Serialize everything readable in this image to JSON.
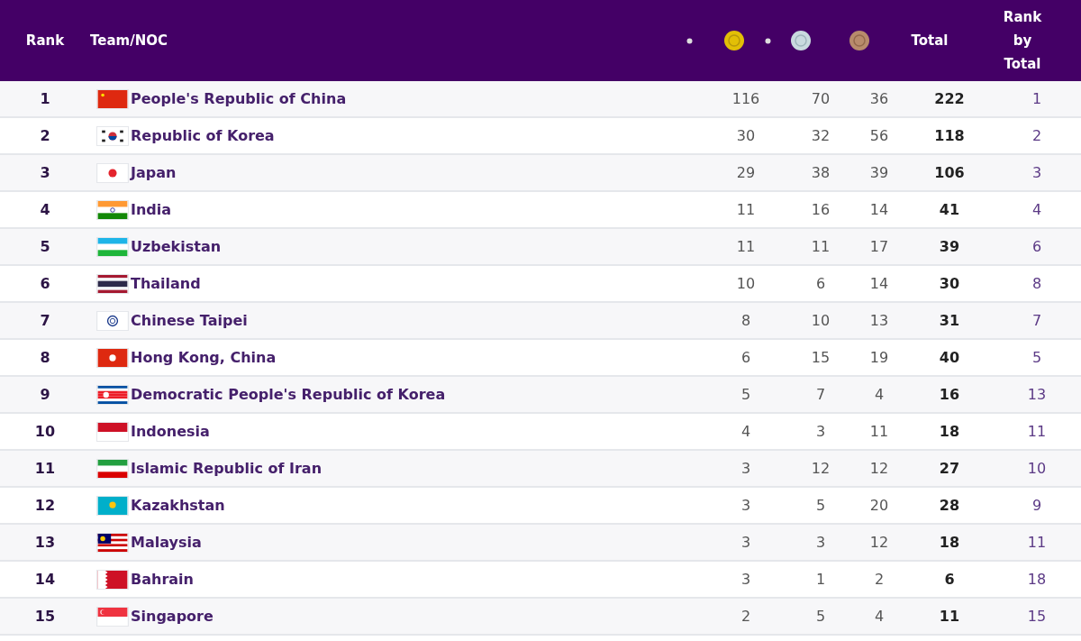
{
  "table": {
    "columns": {
      "rank": "Rank",
      "team": "Team/NOC",
      "total": "Total",
      "rank_by_total": [
        "Rank",
        "by",
        "Total"
      ]
    },
    "rows": [
      {
        "rank": "1",
        "team": "People's Republic of China",
        "gold": "116",
        "silver": "70",
        "bronze": "36",
        "total": "222",
        "rank_by_total": "1"
      },
      {
        "rank": "2",
        "team": "Republic of Korea",
        "gold": "30",
        "silver": "32",
        "bronze": "56",
        "total": "118",
        "rank_by_total": "2"
      },
      {
        "rank": "3",
        "team": "Japan",
        "gold": "29",
        "silver": "38",
        "bronze": "39",
        "total": "106",
        "rank_by_total": "3"
      },
      {
        "rank": "4",
        "team": "India",
        "gold": "11",
        "silver": "16",
        "bronze": "14",
        "total": "41",
        "rank_by_total": "4"
      },
      {
        "rank": "5",
        "team": "Uzbekistan",
        "gold": "11",
        "silver": "11",
        "bronze": "17",
        "total": "39",
        "rank_by_total": "6"
      },
      {
        "rank": "6",
        "team": "Thailand",
        "gold": "10",
        "silver": "6",
        "bronze": "14",
        "total": "30",
        "rank_by_total": "8"
      },
      {
        "rank": "7",
        "team": "Chinese Taipei",
        "gold": "8",
        "silver": "10",
        "bronze": "13",
        "total": "31",
        "rank_by_total": "7"
      },
      {
        "rank": "8",
        "team": "Hong Kong, China",
        "gold": "6",
        "silver": "15",
        "bronze": "19",
        "total": "40",
        "rank_by_total": "5"
      },
      {
        "rank": "9",
        "team": "Democratic People's Republic of Korea",
        "gold": "5",
        "silver": "7",
        "bronze": "4",
        "total": "16",
        "rank_by_total": "13"
      },
      {
        "rank": "10",
        "team": "Indonesia",
        "gold": "4",
        "silver": "3",
        "bronze": "11",
        "total": "18",
        "rank_by_total": "11"
      },
      {
        "rank": "11",
        "team": "Islamic Republic of Iran",
        "gold": "3",
        "silver": "12",
        "bronze": "12",
        "total": "27",
        "rank_by_total": "10"
      },
      {
        "rank": "12",
        "team": "Kazakhstan",
        "gold": "3",
        "silver": "5",
        "bronze": "20",
        "total": "28",
        "rank_by_total": "9"
      },
      {
        "rank": "13",
        "team": "Malaysia",
        "gold": "3",
        "silver": "3",
        "bronze": "12",
        "total": "18",
        "rank_by_total": "11"
      },
      {
        "rank": "14",
        "team": "Bahrain",
        "gold": "3",
        "silver": "1",
        "bronze": "2",
        "total": "6",
        "rank_by_total": "18"
      },
      {
        "rank": "15",
        "team": "Singapore",
        "gold": "2",
        "silver": "5",
        "bronze": "4",
        "total": "11",
        "rank_by_total": "15"
      }
    ]
  }
}
